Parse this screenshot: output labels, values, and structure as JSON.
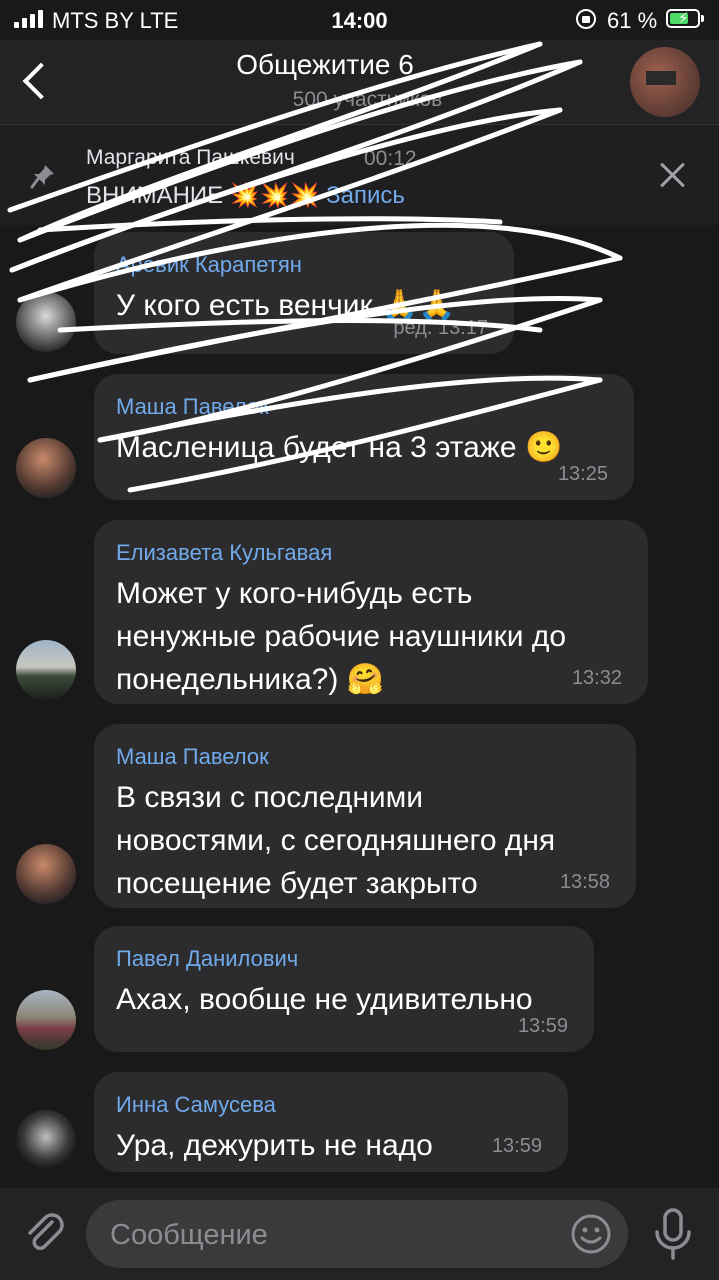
{
  "status_bar": {
    "carrier": "MTS BY   LTE",
    "time": "14:00",
    "battery_percent": "61 %",
    "battery_level": 0.61
  },
  "header": {
    "title": "Общежитие 6",
    "subtitle": "500 участников"
  },
  "pinned": {
    "author": "Маргарита Пашкевич",
    "time": "00:12",
    "text": "ВНИМАНИЕ 💥💥💥",
    "link": "Запись"
  },
  "messages": [
    {
      "author": "Аревик Карапетян",
      "text": "У кого есть венчик 🙏🙏",
      "time": "ред. 13:17"
    },
    {
      "author": "Маша Павелок",
      "text": "Масленица будет на 3 этаже 🙂",
      "time": "13:25"
    },
    {
      "author": "Елизавета Кульгавая",
      "lines": [
        "Может у кого-нибудь есть",
        "ненужные рабочие наушники до",
        "понедельника?) 🤗"
      ],
      "time": "13:32"
    },
    {
      "author": "Маша Павелок",
      "lines": [
        "В связи с последними",
        "новостями, с сегодняшнего дня",
        "посещение будет закрыто"
      ],
      "time": "13:58"
    },
    {
      "author": "Павел Данилович",
      "text": "Ахах, вообще не удивительно",
      "time": "13:59"
    },
    {
      "author": "Инна Самусева",
      "text": "Ура, дежурить не надо",
      "time": "13:59"
    }
  ],
  "composer": {
    "placeholder": "Сообщение"
  },
  "colors": {
    "background": "#19191a",
    "bubble": "#2c2c2e",
    "author_name": "#71aaeb",
    "header": "#232325"
  }
}
